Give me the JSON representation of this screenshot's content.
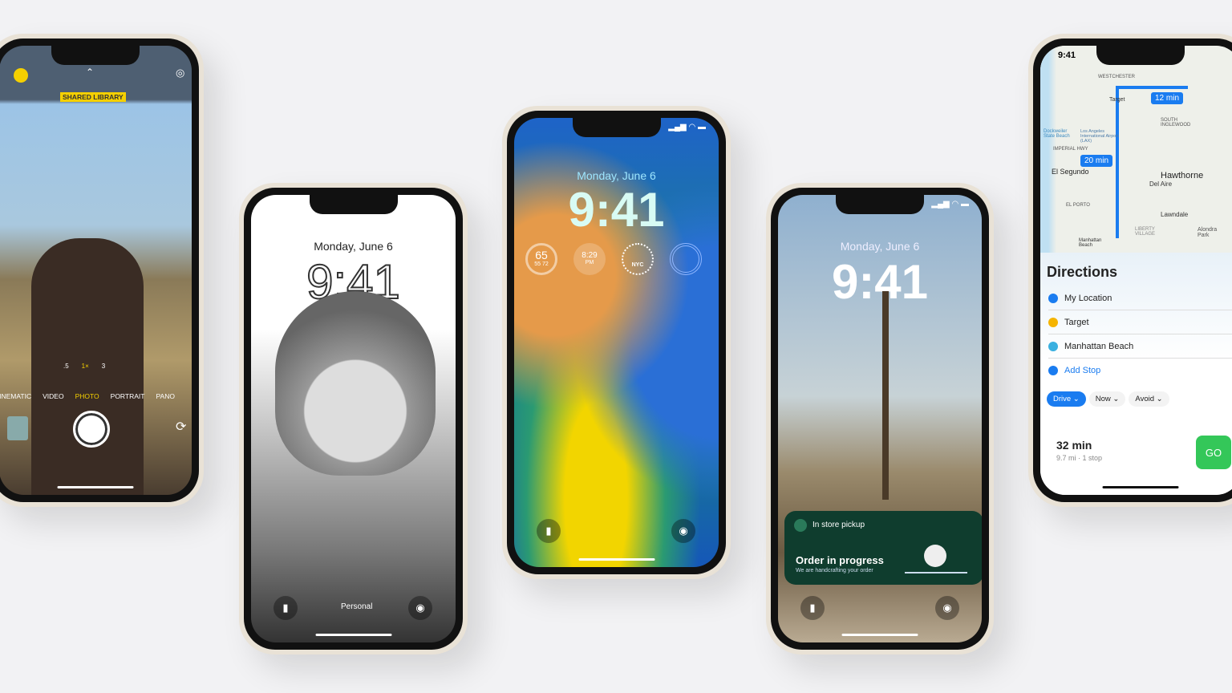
{
  "camera": {
    "shared_library": "SHARED LIBRARY",
    "zoom_levels": [
      ".5",
      "1×",
      "3"
    ],
    "modes": [
      "CINEMATIC",
      "VIDEO",
      "PHOTO",
      "PORTRAIT",
      "PANO"
    ],
    "active_mode": "PHOTO"
  },
  "portrait_lock": {
    "date": "Monday, June 6",
    "time": "9:41",
    "focus": "Personal"
  },
  "center_lock": {
    "date": "Monday, June 6",
    "time": "9:41",
    "widgets": {
      "temp": "65",
      "temp_range": "55  72",
      "sunset_time": "8:29",
      "sunset_ampm": "PM",
      "clock_city": "NYC"
    }
  },
  "desert_lock": {
    "date": "Monday, June 6",
    "time": "9:41",
    "activity": {
      "title": "In store pickup",
      "status": "Order in progress",
      "subtitle": "We are handcrafting your order"
    }
  },
  "maps": {
    "status_time": "9:41",
    "map_labels": [
      "WESTCHESTER",
      "Target",
      "SOUTH INGLEWOOD",
      "Dockweiler State Beach",
      "Los Angeles International Airport (LAX)",
      "IMPERIAL HWY",
      "El Segundo",
      "Hawthorne",
      "Del Aire",
      "EL PORTO",
      "Lawndale",
      "LIBERTY VILLAGE",
      "Alondra Park",
      "Manhattan Beach"
    ],
    "leg1": "12 min",
    "leg2": "20 min",
    "title": "Directions",
    "stops": [
      "My Location",
      "Target",
      "Manhattan Beach"
    ],
    "add_stop": "Add Stop",
    "options": [
      "Drive",
      "Now",
      "Avoid"
    ],
    "duration": "32 min",
    "details": "9.7 mi · 1 stop",
    "go": "GO",
    "colors": {
      "route": "#1a7cf0",
      "go": "#34c759"
    }
  }
}
